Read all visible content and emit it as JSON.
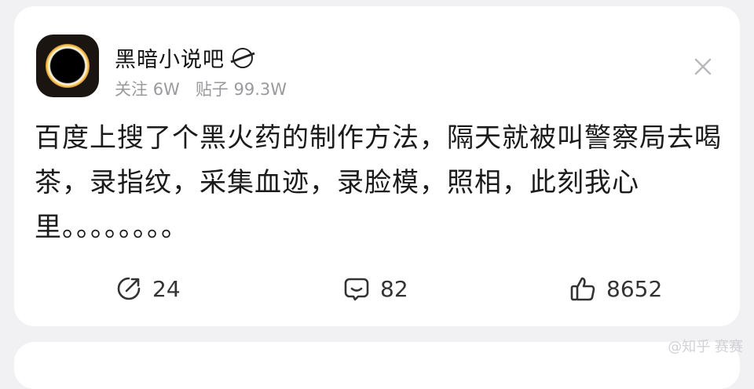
{
  "forum": {
    "name": "黑暗小说吧",
    "followers_label": "关注",
    "followers": "6W",
    "posts_label": "贴子",
    "posts": "99.3W"
  },
  "post": {
    "text": "百度上搜了个黑火药的制作方法，隔天就被叫警察局去喝茶，录指纹，采集血迹，录脸模，照相，此刻我心里。。。。。。。。"
  },
  "actions": {
    "share_count": "24",
    "comment_count": "82",
    "like_count": "8652"
  },
  "icons": {
    "close": "close-icon",
    "share": "share-icon",
    "comment": "comment-icon",
    "like": "thumbs-up-icon",
    "badge": "forum-badge-icon"
  },
  "watermark": "@知乎 赛赛"
}
